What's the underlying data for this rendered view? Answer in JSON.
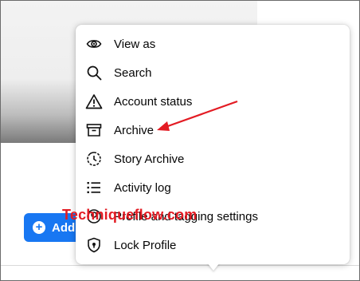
{
  "profile": {
    "add_button_label": "Add",
    "add_button_color": "#1877f2"
  },
  "menu": {
    "items": [
      {
        "label": "View as",
        "icon": "eye-icon"
      },
      {
        "label": "Search",
        "icon": "search-icon"
      },
      {
        "label": "Account status",
        "icon": "warning-icon"
      },
      {
        "label": "Archive",
        "icon": "archive-box-icon"
      },
      {
        "label": "Story Archive",
        "icon": "story-archive-clock-icon"
      },
      {
        "label": "Activity log",
        "icon": "list-icon"
      },
      {
        "label": "Profile and tagging settings",
        "icon": "profile-settings-icon"
      },
      {
        "label": "Lock Profile",
        "icon": "shield-lock-icon"
      }
    ]
  },
  "annotation": {
    "watermark": "Techniqueflow.com",
    "arrow_color": "#e31b23"
  }
}
